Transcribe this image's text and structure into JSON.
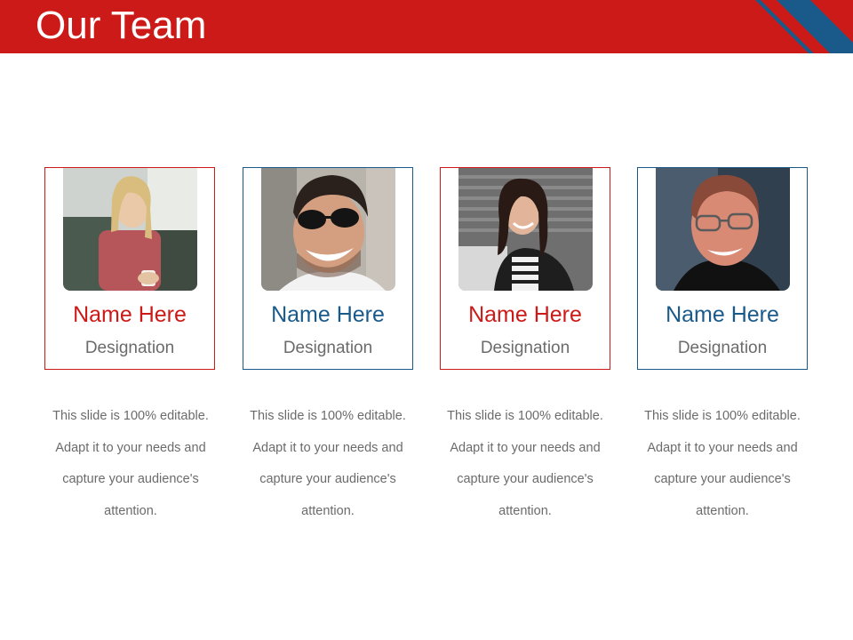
{
  "header": {
    "title": "Our Team"
  },
  "colors": {
    "brand_red": "#cc1a18",
    "brand_blue": "#1a5a8a",
    "text_gray": "#6b6b6b"
  },
  "team": [
    {
      "name": "Name Here",
      "designation": "Designation",
      "description": "This slide is 100% editable. Adapt it to your needs and capture your audience's attention.",
      "accent": "red",
      "photo_icon": "woman-blonde-photo"
    },
    {
      "name": "Name Here",
      "designation": "Designation",
      "description": "This slide is 100% editable. Adapt it to your needs and capture your audience's attention.",
      "accent": "blue",
      "photo_icon": "man-sunglasses-photo"
    },
    {
      "name": "Name Here",
      "designation": "Designation",
      "description": "This slide is 100% editable. Adapt it to your needs and capture your audience's attention.",
      "accent": "red",
      "photo_icon": "woman-brunette-photo"
    },
    {
      "name": "Name Here",
      "designation": "Designation",
      "description": "This slide is 100% editable. Adapt it to your needs and capture your audience's attention.",
      "accent": "blue",
      "photo_icon": "man-glasses-photo"
    }
  ]
}
